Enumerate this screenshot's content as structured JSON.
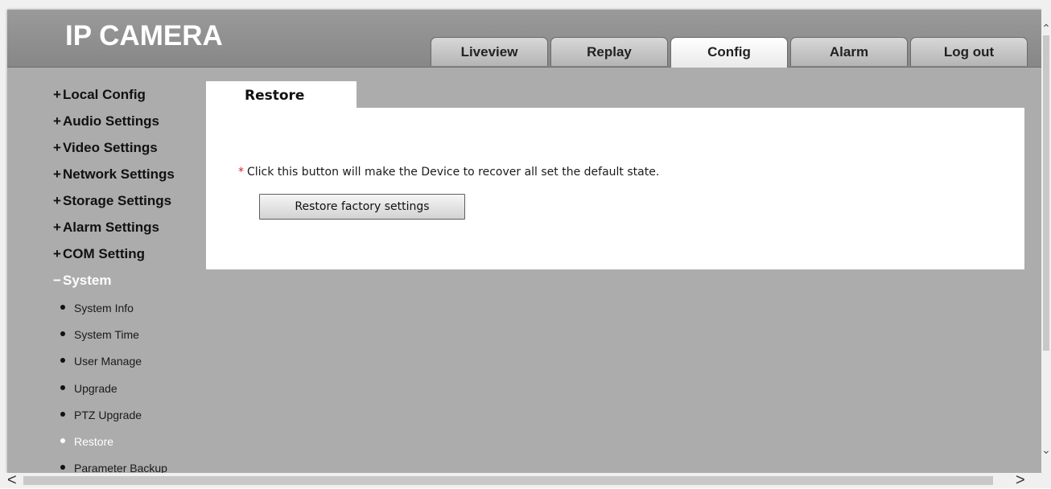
{
  "header": {
    "logo": "IP CAMERA",
    "tabs": [
      {
        "label": "Liveview",
        "active": false
      },
      {
        "label": "Replay",
        "active": false
      },
      {
        "label": "Config",
        "active": true
      },
      {
        "label": "Alarm",
        "active": false
      },
      {
        "label": "Log out",
        "active": false
      }
    ]
  },
  "sidebar": {
    "collapsed_sign": "+",
    "expanded_sign": "−",
    "items": [
      {
        "label": "Local Config"
      },
      {
        "label": "Audio Settings"
      },
      {
        "label": "Video Settings"
      },
      {
        "label": "Network Settings"
      },
      {
        "label": "Storage Settings"
      },
      {
        "label": "Alarm Settings"
      },
      {
        "label": "COM Setting"
      },
      {
        "label": "System"
      }
    ],
    "system_subitems": [
      {
        "label": "System Info"
      },
      {
        "label": "System Time"
      },
      {
        "label": "User Manage"
      },
      {
        "label": "Upgrade"
      },
      {
        "label": "PTZ Upgrade"
      },
      {
        "label": "Restore"
      },
      {
        "label": "Parameter Backup"
      }
    ]
  },
  "main": {
    "tab_label": "Restore",
    "notice_marker": "*",
    "notice_text": "Click this button will make the Device to recover all set the default state.",
    "restore_button_label": "Restore factory settings"
  },
  "scrollbars": {
    "up_arrow": "⌃",
    "down_arrow": "⌄",
    "left_arrow": "<",
    "right_arrow": ">"
  },
  "colors": {
    "header_bg": "#8f8f8f",
    "page_bg": "#acacac",
    "panel_bg": "#ffffff",
    "active_menu_text": "#ffffff",
    "required_marker": "#e02020"
  }
}
